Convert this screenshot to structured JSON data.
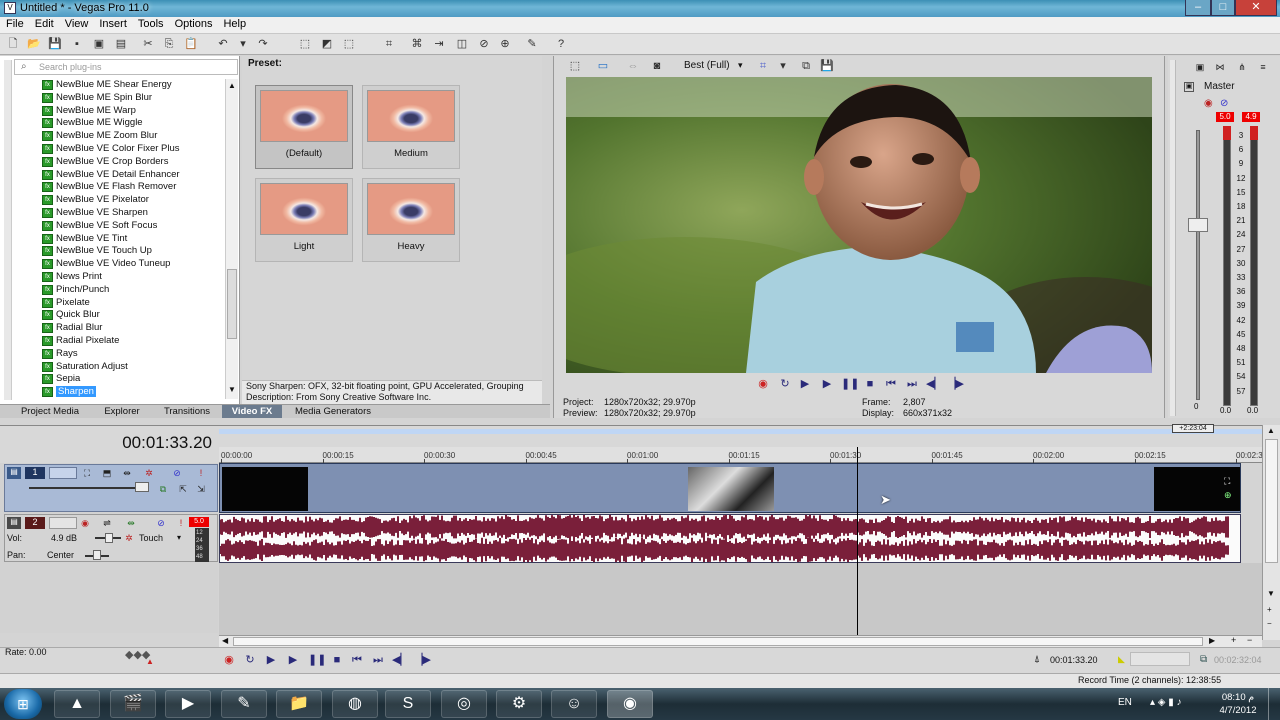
{
  "window": {
    "title": "Untitled * - Vegas Pro 11.0",
    "minimize": "–",
    "maximize": "□",
    "close": "✕"
  },
  "menu": [
    "File",
    "Edit",
    "View",
    "Insert",
    "Tools",
    "Options",
    "Help"
  ],
  "plugins": {
    "search_placeholder": "Search plug-ins",
    "items": [
      "NewBlue ME Shear Energy",
      "NewBlue ME Spin Blur",
      "NewBlue ME Warp",
      "NewBlue ME Wiggle",
      "NewBlue ME Zoom Blur",
      "NewBlue VE Color Fixer Plus",
      "NewBlue VE Crop Borders",
      "NewBlue VE Detail Enhancer",
      "NewBlue VE Flash Remover",
      "NewBlue VE Pixelator",
      "NewBlue VE Sharpen",
      "NewBlue VE Soft Focus",
      "NewBlue VE Tint",
      "NewBlue VE Touch Up",
      "NewBlue VE Video Tuneup",
      "News Print",
      "Pinch/Punch",
      "Pixelate",
      "Quick Blur",
      "Radial Blur",
      "Radial Pixelate",
      "Rays",
      "Saturation Adjust",
      "Sepia",
      "Sharpen"
    ],
    "selected": "Sharpen"
  },
  "presets": {
    "header": "Preset:",
    "items": [
      "(Default)",
      "Medium",
      "Light",
      "Heavy"
    ],
    "selected": "(Default)",
    "description_line1": "Sony Sharpen: OFX, 32-bit floating point, GPU Accelerated, Grouping",
    "description_line2": "Description: From Sony Creative Software Inc."
  },
  "tabs": [
    "Project Media",
    "Explorer",
    "Transitions",
    "Video FX",
    "Media Generators"
  ],
  "active_tab": "Video FX",
  "preview": {
    "quality": "Best (Full)",
    "project_label": "Project:",
    "project_value": "1280x720x32; 29.970p",
    "preview_label": "Preview:",
    "preview_value": "1280x720x32; 29.970p",
    "frame_label": "Frame:",
    "frame_value": "2,807",
    "display_label": "Display:",
    "display_value": "660x371x32"
  },
  "master": {
    "label": "Master",
    "peak_left": "5.0",
    "peak_right": "4.9",
    "scale": [
      "3",
      "6",
      "9",
      "12",
      "15",
      "18",
      "21",
      "24",
      "27",
      "30",
      "33",
      "36",
      "39",
      "42",
      "45",
      "48",
      "51",
      "54",
      "57"
    ],
    "level_left": "0.0",
    "level_right": "0.0",
    "fader_zero": "0"
  },
  "timeline": {
    "current_time": "00:01:33.20",
    "ruler": [
      "00:00:00",
      "00:00:15",
      "00:00:30",
      "00:00:45",
      "00:01:00",
      "00:01:15",
      "00:01:30",
      "00:01:45",
      "00:02:00",
      "00:02:15",
      "00:02:30"
    ],
    "region_end": "+2:23:04",
    "video_track_number": "1",
    "audio_track_number": "2",
    "audio_peak": "5.0",
    "vol_label": "Vol:",
    "vol_value": "4.9 dB",
    "touch_label": "Touch",
    "pan_label": "Pan:",
    "pan_value": "Center",
    "meter_scale": [
      "12",
      "24",
      "36",
      "48"
    ],
    "playhead_fraction": 0.612
  },
  "bottom": {
    "rate_label": "Rate: 0.00",
    "cursor_time": "00:01:33.20",
    "length_time": "00:02:32:04"
  },
  "status": {
    "record_time": "Record Time (2 channels): 12:38:55"
  },
  "taskbar": {
    "lang": "EN",
    "time": "08:10 م",
    "date": "4/7/2012",
    "apps": [
      "vlc-icon",
      "movie-icon",
      "media-icon",
      "pen-icon",
      "folder-icon",
      "firefox-icon",
      "skype-icon",
      "chrome-icon",
      "steam-icon",
      "people-icon",
      "vegas-icon"
    ]
  }
}
